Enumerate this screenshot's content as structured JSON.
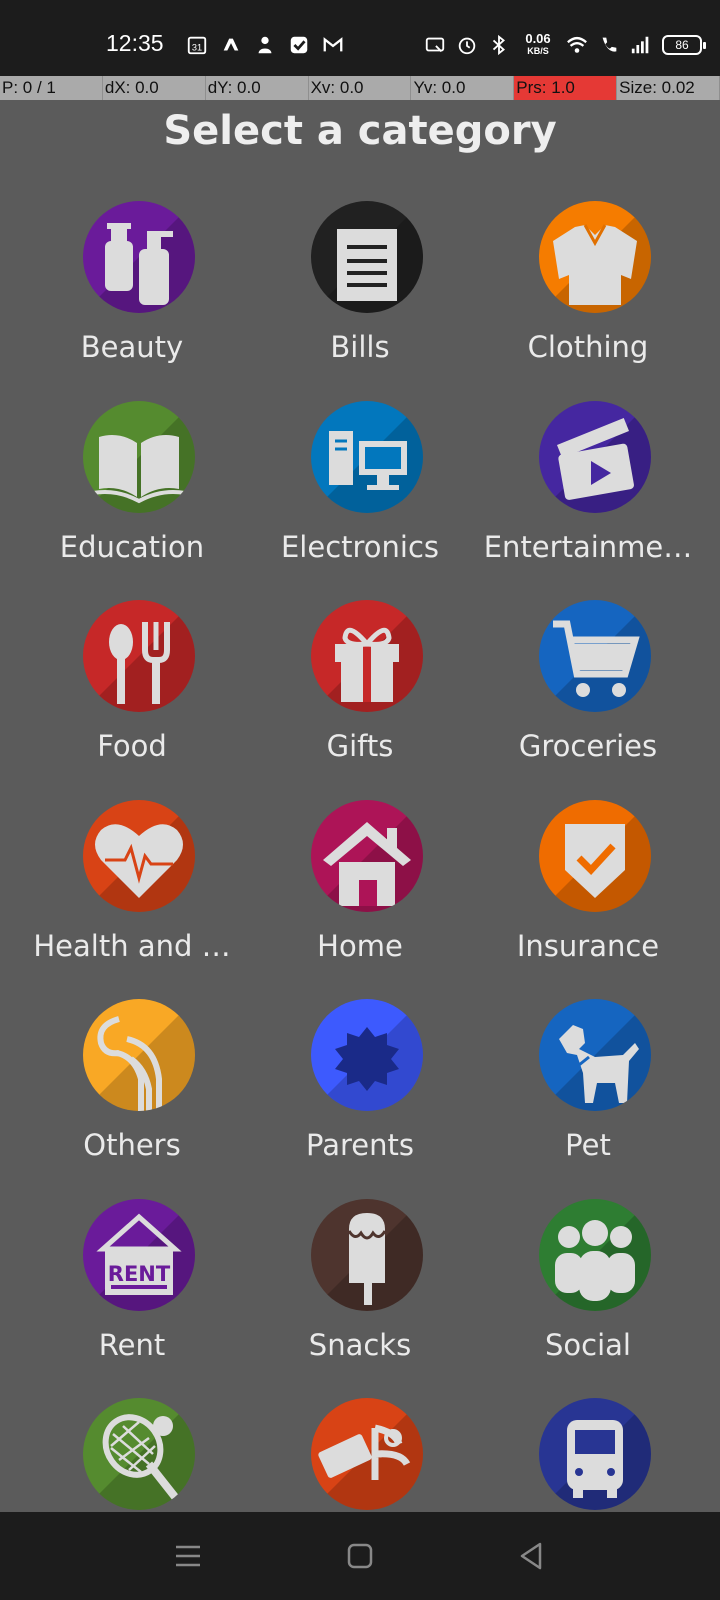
{
  "status_bar": {
    "time": "12:35",
    "left_icons": [
      "calendar-icon",
      "app-icon",
      "person-icon",
      "check-icon",
      "gmail-icon"
    ],
    "right_icons": [
      "cast-icon",
      "alarm-icon",
      "bluetooth-icon",
      "wifi-icon",
      "call-icon",
      "signal-icon"
    ],
    "net_speed": "0.06",
    "net_unit": "KB/S",
    "battery": "86"
  },
  "overlay": {
    "p": "P: 0 / 1",
    "dx": "dX: 0.0",
    "dy": "dY: 0.0",
    "xv": "Xv: 0.0",
    "yv": "Yv: 0.0",
    "prs": "Prs: 1.0",
    "size": "Size: 0.02"
  },
  "title": "Select a category",
  "categories": [
    {
      "label": "Beauty",
      "color": "#6a1b9a",
      "icon": "beauty-icon"
    },
    {
      "label": "Bills",
      "color": "#212121",
      "icon": "bills-icon"
    },
    {
      "label": "Clothing",
      "color": "#f57c00",
      "icon": "clothing-icon"
    },
    {
      "label": "Education",
      "color": "#558b2f",
      "icon": "education-icon"
    },
    {
      "label": "Electronics",
      "color": "#0277bd",
      "icon": "electronics-icon"
    },
    {
      "label": "Entertainme…",
      "color": "#4527a0",
      "icon": "entertainment-icon"
    },
    {
      "label": "Food",
      "color": "#c62828",
      "icon": "food-icon"
    },
    {
      "label": "Gifts",
      "color": "#c62828",
      "icon": "gifts-icon"
    },
    {
      "label": "Groceries",
      "color": "#1565c0",
      "icon": "groceries-icon"
    },
    {
      "label": "Health and …",
      "color": "#d84315",
      "icon": "health-icon"
    },
    {
      "label": "Home",
      "color": "#ad1457",
      "icon": "home-icon"
    },
    {
      "label": "Insurance",
      "color": "#ef6c00",
      "icon": "insurance-icon"
    },
    {
      "label": "Others",
      "color": "#f9a825",
      "icon": "others-icon"
    },
    {
      "label": "Parents",
      "color": "#3d5afe",
      "icon": "parents-icon"
    },
    {
      "label": "Pet",
      "color": "#1565c0",
      "icon": "pet-icon"
    },
    {
      "label": "Rent",
      "color": "#6a1b9a",
      "icon": "rent-icon",
      "icon_text": "RENT"
    },
    {
      "label": "Snacks",
      "color": "#4e342e",
      "icon": "snacks-icon"
    },
    {
      "label": "Social",
      "color": "#2e7d32",
      "icon": "social-icon"
    },
    {
      "label": "",
      "color": "#558b2f",
      "icon": "sports-icon"
    },
    {
      "label": "",
      "color": "#d84315",
      "icon": "tools-icon"
    },
    {
      "label": "",
      "color": "#283593",
      "icon": "transport-icon"
    }
  ],
  "nav": {
    "icons": [
      "menu-icon",
      "home-square-icon",
      "back-icon"
    ]
  }
}
